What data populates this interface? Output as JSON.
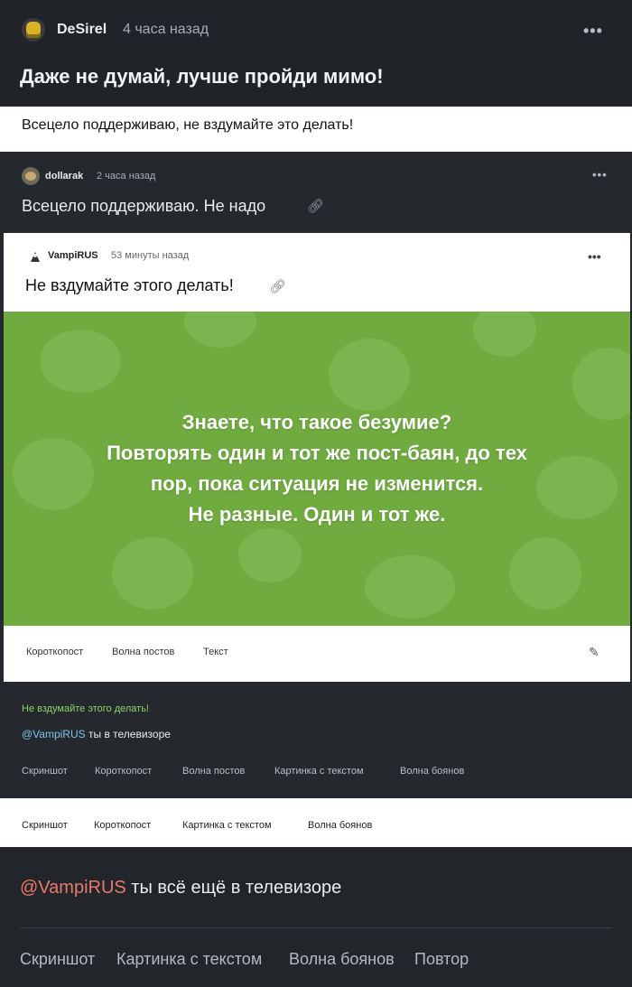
{
  "top_post": {
    "author": "DeSirel",
    "time": "4 часа назад",
    "title": "Даже не думай, лучше пройди мимо!",
    "more_icon": "more-dots-icon"
  },
  "reply_banner": "Всецело поддерживаю, не вздумайте это делать!",
  "comment_1": {
    "author": "dollarak",
    "time": "2 часа назад",
    "text": "Всецело поддерживаю. Не надо"
  },
  "embedded_post": {
    "author": "VampiRUS",
    "time": "53 минуты назад",
    "title": "Не вздумайте этого делать!",
    "meme_lines": [
      "Знаете, что такое безумие?",
      "Повторять один и тот же пост-баян, до тех",
      "пор, пока ситуация не изменится.",
      "Не разные. Один и тот же."
    ],
    "tags": [
      "Короткопост",
      "Волна постов",
      "Текст"
    ]
  },
  "inner_comment": {
    "green_text": "Не вздумайте этого делать!",
    "mention": "@VampiRUS",
    "text": "ты в телевизоре",
    "tags": [
      "Скриншот",
      "Короткопост",
      "Волна постов",
      "Картинка с текстом",
      "Волна боянов"
    ]
  },
  "middle_tags": [
    "Скриншот",
    "Короткопост",
    "Картинка с текстом",
    "Волна боянов"
  ],
  "bottom": {
    "mention": "@VampiRUS",
    "text": "ты всё ещё в телевизоре",
    "tags": [
      "Скриншот",
      "Картинка с текстом",
      "Волна боянов",
      "Повтор"
    ]
  },
  "colors": {
    "meme_background": "#6fab3f",
    "mention_light": "#7fc2e8",
    "mention_red": "#e97a6b",
    "green_text": "#8fd26b"
  }
}
